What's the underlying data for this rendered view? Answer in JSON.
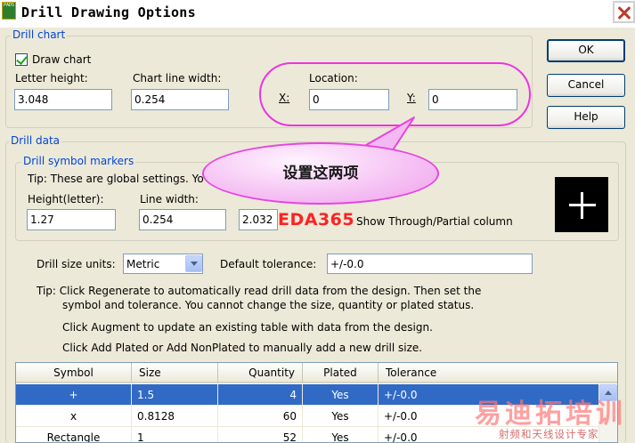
{
  "window": {
    "icon_text": "PADS",
    "title": "Drill Drawing Options"
  },
  "buttons": {
    "ok": "OK",
    "cancel": "Cancel",
    "help": "Help"
  },
  "drill_chart": {
    "legend": "Drill chart",
    "draw_chart_label": "Draw chart",
    "draw_chart_checked": true,
    "letter_height_label": "Letter height:",
    "letter_height_value": "3.048",
    "chart_line_width_label": "Chart line width:",
    "chart_line_width_value": "0.254",
    "location_label": "Location:",
    "x_label": "X:",
    "x_value": "0",
    "y_label": "Y:",
    "y_value": "0"
  },
  "drill_data": {
    "legend": "Drill data",
    "markers": {
      "legend": "Drill symbol markers",
      "tip": "Tip: These are global settings. Yo",
      "height_label": "Height(letter):",
      "height_value": "1.27",
      "line_width_label": "Line width:",
      "line_width_value": "0.254",
      "third_value": "2.032",
      "show_through_label": "Show Through/Partial column"
    },
    "units_label": "Drill size units:",
    "units_value": "Metric",
    "tolerance_label": "Default tolerance:",
    "tolerance_value": "+/-0.0",
    "tip1_line1": "Tip: Click Regenerate to automatically read drill data from the design. Then set the",
    "tip1_line2": "symbol and tolerance. You cannot change the size, quantity or plated status.",
    "tip2": "Click Augment to update an existing table with data from the design.",
    "tip3": "Click Add Plated or Add NonPlated to manually add a new drill size."
  },
  "table": {
    "headers": [
      "Symbol",
      "Size",
      "Quantity",
      "Plated",
      "Tolerance"
    ],
    "rows": [
      {
        "symbol": "+",
        "size": "1.5",
        "quantity": "4",
        "plated": "Yes",
        "tolerance": "+/-0.0",
        "selected": true
      },
      {
        "symbol": "x",
        "size": "0.8128",
        "quantity": "60",
        "plated": "Yes",
        "tolerance": "+/-0.0",
        "selected": false
      },
      {
        "symbol": "Rectangle",
        "size": "1",
        "quantity": "52",
        "plated": "Yes",
        "tolerance": "+/-0.0",
        "selected": false
      }
    ]
  },
  "annotations": {
    "callout": "设置这两项",
    "watermark_eda": "EDA365",
    "watermark_cn": "易迪拓培训",
    "watermark_cn_sub": "射频和天线设计专家"
  },
  "colors": {
    "legend_blue": "#0046d5",
    "selection": "#316ac5",
    "annotation_magenta": "#ee33e0",
    "watermark_red": "#ff2222"
  }
}
